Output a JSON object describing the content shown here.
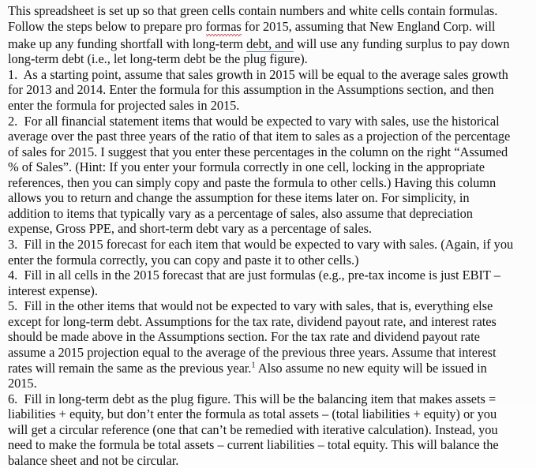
{
  "document": {
    "type": "scanned-text-page",
    "font_style": "serif",
    "background_color": "#fcfcfc",
    "text_color": "#151515",
    "spellcheck_underline_color": "#c1272d",
    "grammar_underline_color": "#5d7fa4",
    "clipped_top_line": "",
    "intro": {
      "part1": "This spreadsheet is set up so that green cells contain numbers and white cells contain formulas. Follow the steps below to prepare pro ",
      "spellcheck_word": "formas",
      "part2": " for 2015, assuming that New England Corp. will make up any funding shortfall with long-term ",
      "grammar_phrase": "debt, and",
      "part3": " will use any funding surplus to pay down long-term debt (i.e., let long-term debt be the plug figure)."
    },
    "steps": [
      {
        "number": "1.",
        "text": "As a starting point, assume that sales growth in 2015 will be equal to the average sales growth for 2013 and 2014.  Enter the formula for this assumption in the Assumptions section, and then enter the formula for projected sales in 2015."
      },
      {
        "number": "2.",
        "text": "For all financial statement items that would be expected to vary with sales, use the historical average over the past three years of the ratio of that item to sales as a projection of the percentage of sales for 2015.  I suggest that you enter these percentages in the column on the right “Assumed % of Sales”.  (Hint:  If you enter your formula correctly in one cell, locking in the appropriate references, then you can simply copy and paste the formula to other cells.)  Having this column allows you to return and change the assumption for these items later on.  For simplicity, in addition to items that typically vary as a percentage of sales, also assume that depreciation expense, Gross PPE, and short-term debt vary as a percentage of sales."
      },
      {
        "number": "3.",
        "text": "Fill in the 2015 forecast for each item that would be expected to vary with sales.  (Again, if you enter the formula correctly, you can copy and paste it to other cells.)"
      },
      {
        "number": "4.",
        "text": "Fill in all cells in the 2015 forecast that are just formulas (e.g., pre-tax income is just EBIT – interest expense)."
      },
      {
        "number": "5.",
        "text_before_footnote": "Fill in the other items that would not be expected to vary with sales, that is, everything else except for long-term debt.  Assumptions for the tax rate, dividend payout rate, and interest rates should be made above in the Assumptions section.  For the tax rate and dividend payout rate assume a 2015 projection equal to the average of the previous three years.  Assume that interest rates will remain the same as the previous year.",
        "footnote_marker": "1",
        "text_after_footnote": "  Also assume no new equity will be issued in 2015."
      },
      {
        "number": "6.",
        "text": "Fill in long-term debt as the plug figure.  This will be the balancing item that makes assets = liabilities + equity, but don’t enter the formula as total assets – (total liabilities + equity) or you will get a circular reference (one that can’t be remedied with iterative calculation).  Instead, you need to make the formula be total assets – current liabilities – total equity.  This will balance the balance sheet and not be circular."
      }
    ]
  }
}
